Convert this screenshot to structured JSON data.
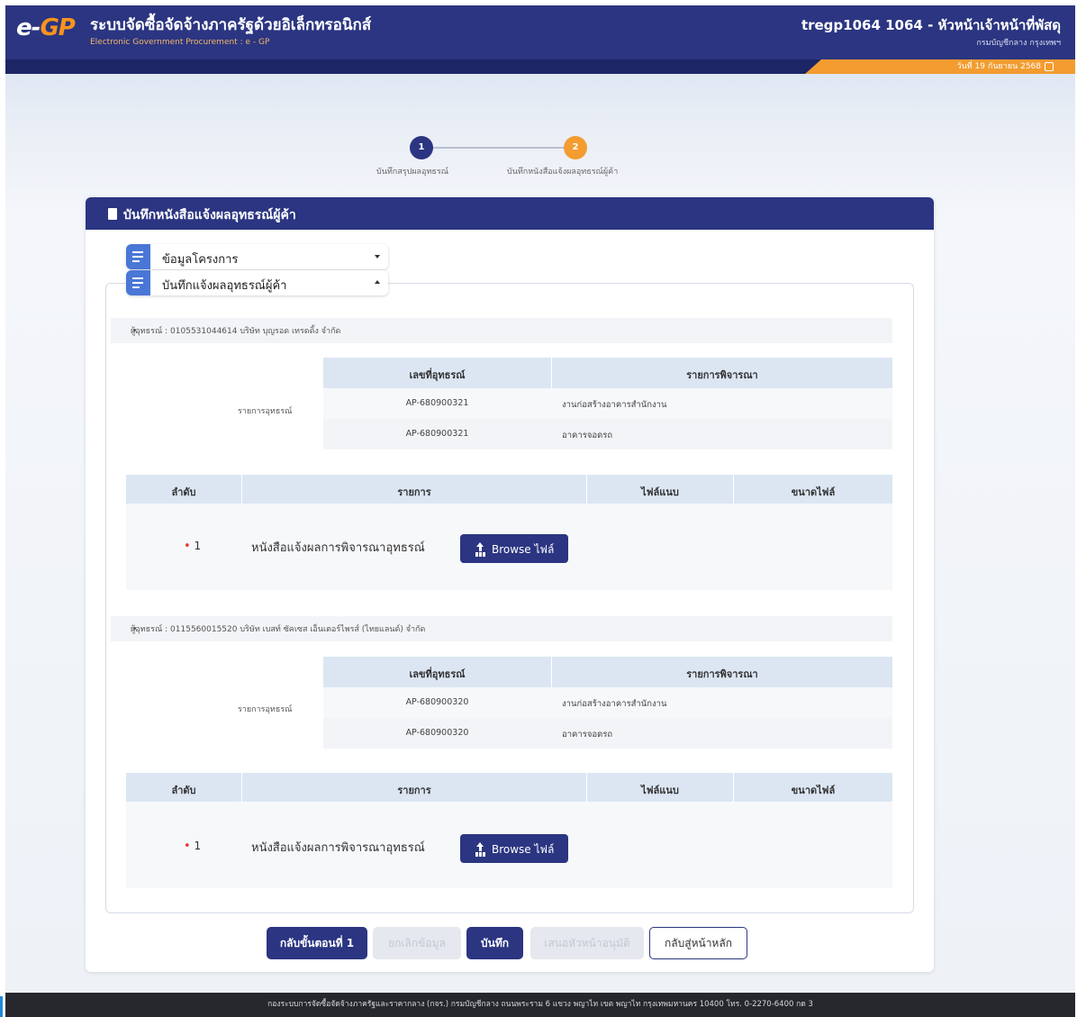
{
  "header": {
    "logo_main": "e-",
    "logo_accent": "GP",
    "title": "ระบบจัดซื้อจัดจ้างภาครัฐด้วยอิเล็กทรอนิกส์",
    "subtitle": "Electronic Government Procurement : e - GP",
    "user": "tregp1064 1064 - หัวหน้าเจ้าหน้าที่พัสดุ",
    "department": "กรมบัญชีกลาง กรุงเทพฯ",
    "date": "วันที่ 19 กันยายน 2568"
  },
  "stepper": {
    "steps": [
      {
        "number": "1",
        "label": "บันทึกสรุปผลอุทธรณ์"
      },
      {
        "number": "2",
        "label": "บันทึกหนังสือแจ้งผลอุทธรณ์ผู้ค้า"
      }
    ]
  },
  "card": {
    "title": "บันทึกหนังสือแจ้งผลอุทธรณ์ผู้ค้า",
    "accordion_project": "ข้อมูลโครงการ",
    "accordion_notice": "บันทึกแจ้งผลอุทธรณ์ผู้ค้า"
  },
  "appeals_table": {
    "side_label": "รายการอุทธรณ์",
    "col_number": "เลขที่อุทธรณ์",
    "col_item": "รายการพิจารณา"
  },
  "files_table": {
    "col_seq": "ลำดับ",
    "col_item": "รายการ",
    "col_file": "ไฟล์แนบ",
    "col_size": "ขนาดไฟล์"
  },
  "vendors": [
    {
      "label": "ผู้อุทธรณ์ : 0105531044614 บริษัท บุญรอด เทรดดิ้ง จำกัด",
      "appeals": [
        {
          "number": "AP-680900321",
          "item": "งานก่อสร้างอาคารสำนักงาน"
        },
        {
          "number": "AP-680900321",
          "item": "อาคารจอดรถ"
        }
      ],
      "file_row": {
        "required_mark": "•",
        "seq": "1",
        "name": "หนังสือแจ้งผลการพิจารณาอุทธรณ์",
        "button": "Browse ไฟล์"
      }
    },
    {
      "label": "ผู้อุทธรณ์ : 0115560015520 บริษัท เบสท์ ซัคเซส เอ็นเตอร์ไพรส์ (ไทยแลนด์) จำกัด",
      "appeals": [
        {
          "number": "AP-680900320",
          "item": "งานก่อสร้างอาคารสำนักงาน"
        },
        {
          "number": "AP-680900320",
          "item": "อาคารจอดรถ"
        }
      ],
      "file_row": {
        "required_mark": "•",
        "seq": "1",
        "name": "หนังสือแจ้งผลการพิจารณาอุทธรณ์",
        "button": "Browse ไฟล์"
      }
    }
  ],
  "actions": {
    "back_step1": "กลับขั้นตอนที่ 1",
    "cancel_data": "ยกเลิกข้อมูล",
    "save": "บันทึก",
    "send_approve": "เสนอหัวหน้าอนุมัติ",
    "back_home": "กลับสู่หน้าหลัก"
  },
  "footer": {
    "text": "กองระบบการจัดซื้อจัดจ้างภาครัฐและราคากลาง (กจร.) กรมบัญชีกลาง ถนนพระราม 6 แขวง พญาไท เขต พญาไท กรุงเทพมหานคร 10400 โทร. 0-2270-6400 กด 3"
  },
  "colors": {
    "brand": "#2b3581",
    "accent": "#f39c30",
    "table_header": "#dce6f3"
  }
}
